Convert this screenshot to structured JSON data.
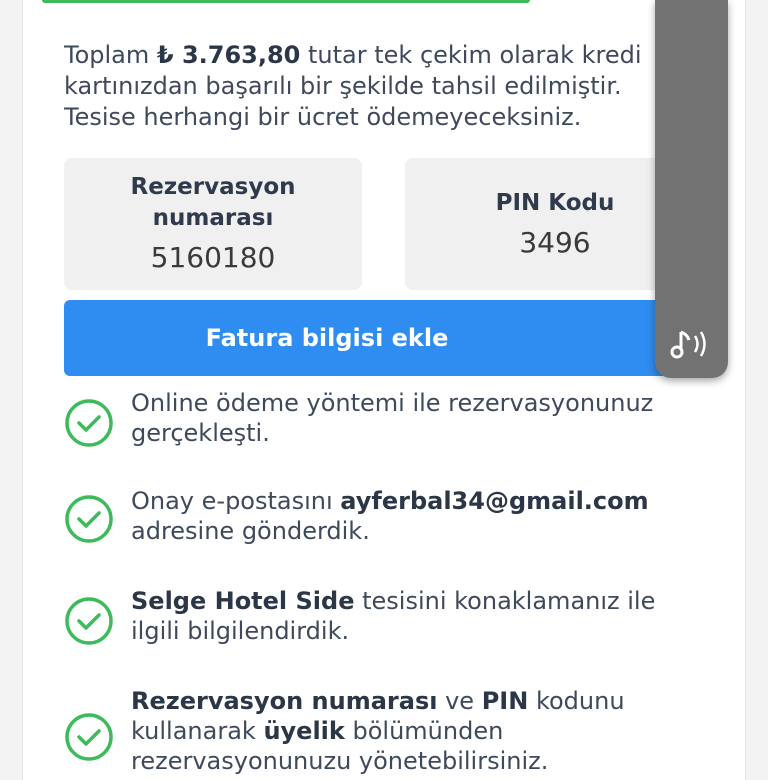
{
  "payment": {
    "prefix": "Toplam ",
    "amount": "₺ 3.763,80",
    "line1_rest": " tutar tek çekim olarak kredi",
    "line2": "kartınızdan başarılı bir şekilde tahsil edilmiştir.",
    "line3": "Tesise herhangi bir ücret ödemeyeceksiniz."
  },
  "reservation": {
    "label_line1": "Rezervasyon",
    "label_line2": "numarası",
    "value": "5160180"
  },
  "pin": {
    "label": "PIN Kodu",
    "value": "3496"
  },
  "invoice_button": {
    "label": "Fatura bilgisi ekle"
  },
  "audio": {
    "icon": "audio-note-icon"
  },
  "confirmations": {
    "item1": {
      "line1": "Online ödeme yöntemi ile rezervasyonunuz",
      "line2": "gerçekleşti."
    },
    "item2": {
      "text_a": "Onay e-postasını ",
      "email": "ayferbal34@gmail.com",
      "line2": "adresine gönderdik."
    },
    "item3": {
      "hotel": "Selge Hotel Side",
      "text_b": " tesisini konaklamanız ile",
      "line2": "ilgili bilgilendirdik."
    },
    "item4": {
      "bold_a": "Rezervasyon numarası",
      "text_a": " ve ",
      "bold_b": "PIN",
      "text_b": " kodunu",
      "text_c": "kullanarak ",
      "bold_c": "üyelik",
      "text_d": " bölümünden",
      "line3": "rezervasyonunuzu yönetebilirsiniz."
    }
  },
  "colors": {
    "accent": "#2f8cf0",
    "success": "#3dbb5a",
    "panel": "#727272"
  }
}
